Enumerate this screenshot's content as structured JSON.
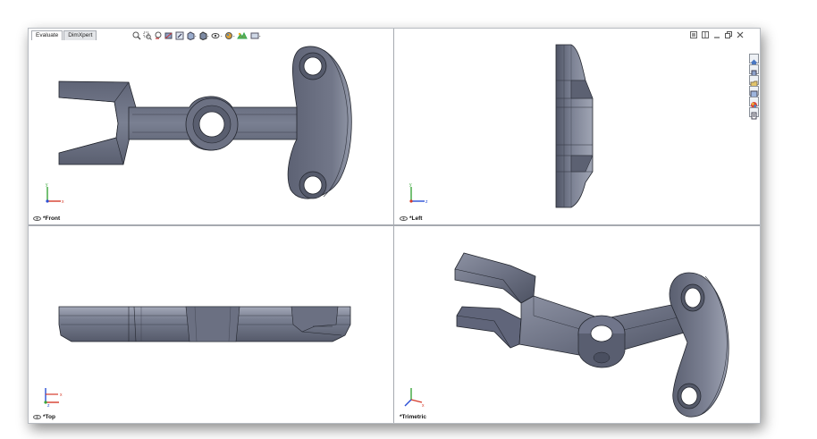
{
  "tabs": [
    {
      "label": "Evaluate",
      "active": true
    },
    {
      "label": "DimXpert",
      "active": false
    }
  ],
  "heads_up_toolbar": [
    "zoom-to-fit-icon",
    "zoom-to-area-icon",
    "previous-view-icon",
    "section-view-icon",
    "dynamic-annotation-icon",
    "view-orientation-icon",
    "display-style-icon",
    "hide-show-items-icon",
    "edit-appearance-icon",
    "apply-scene-icon",
    "view-settings-icon"
  ],
  "window_controls": [
    "restore-icon",
    "tile-icon",
    "minimize-icon",
    "maximize-icon",
    "close-icon"
  ],
  "task_pane": [
    "home-icon",
    "design-library-icon",
    "file-explorer-icon",
    "view-palette-icon",
    "appearances-icon",
    "custom-properties-icon"
  ],
  "viewports": {
    "front": {
      "label": "*Front"
    },
    "left": {
      "label": "*Left"
    },
    "top": {
      "label": "*Top"
    },
    "trimetric": {
      "label": "*Trimetric"
    }
  },
  "colors": {
    "model_face": "#6e7384",
    "model_light": "#a4a9b8",
    "model_dark": "#454a5a",
    "edge": "#22252e",
    "axis_x": "#d63a2a",
    "axis_y": "#3aa63a",
    "axis_z": "#2a4fd6"
  }
}
